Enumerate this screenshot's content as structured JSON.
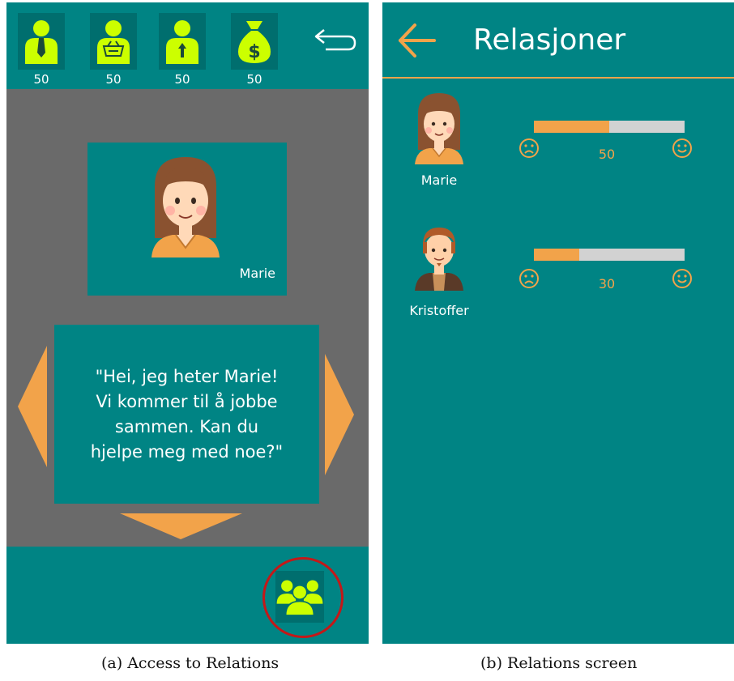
{
  "left_screen": {
    "resources": [
      {
        "icon": "worker-tie-icon",
        "value": "50"
      },
      {
        "icon": "worker-basket-icon",
        "value": "50"
      },
      {
        "icon": "worker-arrow-icon",
        "value": "50"
      },
      {
        "icon": "money-bag-icon",
        "value": "50"
      }
    ],
    "character_name": "Marie",
    "dialogue": "\"Hei, jeg heter Marie!\nVi kommer til å jobbe\nsammen. Kan du\nhjelpe meg med noe?\"",
    "caption": "(a) Access to Relations"
  },
  "right_screen": {
    "title": "Relasjoner",
    "relations": [
      {
        "name": "Marie",
        "value": "50",
        "level": 0.5
      },
      {
        "name": "Kristoffer",
        "value": "30",
        "level": 0.3
      }
    ],
    "caption": "(b) Relations screen"
  },
  "colors": {
    "teal": "#008484",
    "dark_teal": "#006e6e",
    "gray_background": "#6a6a6a",
    "orange_accent": "#f2a34a",
    "lime_icon": "#ccff00",
    "highlight_ring": "#c41818"
  }
}
